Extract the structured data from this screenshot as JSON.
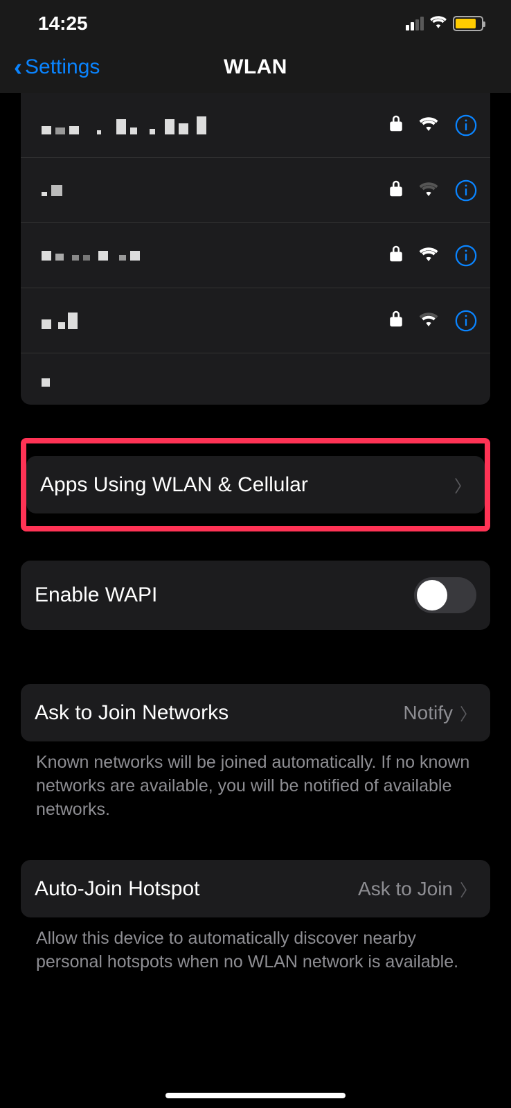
{
  "status_bar": {
    "time": "14:25"
  },
  "nav": {
    "back_label": "Settings",
    "title": "WLAN"
  },
  "networks": [
    {
      "name_redacted": true,
      "locked": true,
      "signal": "strong"
    },
    {
      "name_redacted": true,
      "locked": true,
      "signal": "weak"
    },
    {
      "name_redacted": true,
      "locked": true,
      "signal": "strong"
    },
    {
      "name_redacted": true,
      "locked": true,
      "signal": "medium"
    },
    {
      "name_redacted": true,
      "locked": false,
      "signal": "none"
    }
  ],
  "rows": {
    "apps_label": "Apps Using WLAN & Cellular",
    "wapi_label": "Enable WAPI",
    "wapi_enabled": false,
    "ask_join_label": "Ask to Join Networks",
    "ask_join_value": "Notify",
    "ask_join_footer": "Known networks will be joined automatically. If no known networks are available, you will be notified of available networks.",
    "auto_hotspot_label": "Auto-Join Hotspot",
    "auto_hotspot_value": "Ask to Join",
    "auto_hotspot_footer": "Allow this device to automatically discover nearby personal hotspots when no WLAN network is available."
  }
}
